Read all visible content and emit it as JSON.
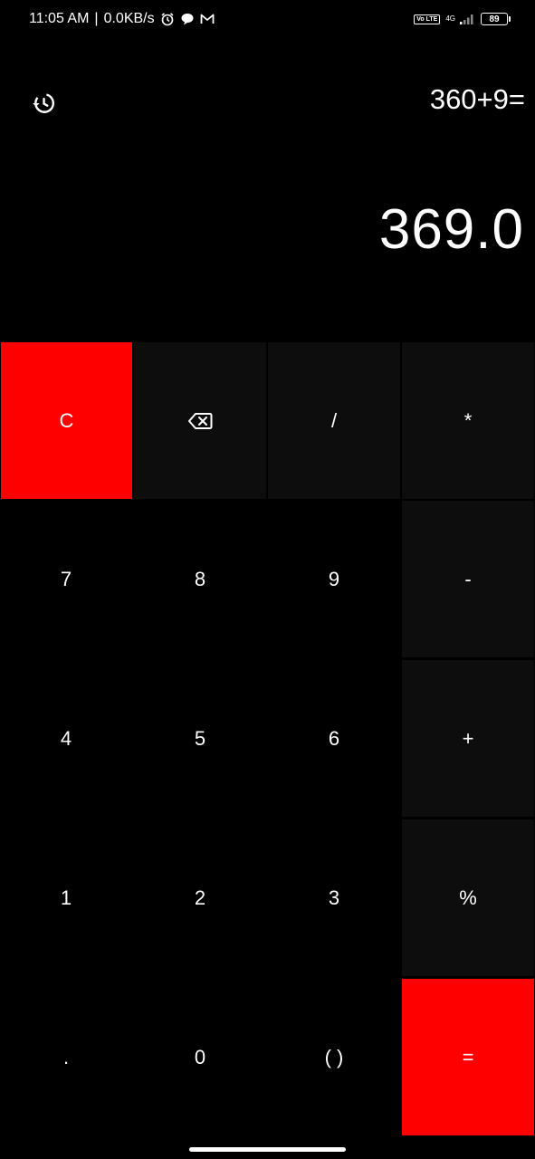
{
  "status_bar": {
    "time": "11:05 AM",
    "separator": "|",
    "network_speed": "0.0KB/s",
    "volte_label": "Vo LTE",
    "network_type": "4G",
    "battery": "89",
    "icons": [
      "alarm-icon",
      "chat-bubble-icon",
      "gmail-icon",
      "volte-icon",
      "signal-icon",
      "battery-icon"
    ]
  },
  "display": {
    "expression": "360+9=",
    "result": "369.0",
    "history_icon": "history-icon"
  },
  "keypad": {
    "clear": "C",
    "backspace_icon": "backspace-icon",
    "divide": "/",
    "multiply": "*",
    "seven": "7",
    "eight": "8",
    "nine": "9",
    "minus": "-",
    "four": "4",
    "five": "5",
    "six": "6",
    "plus": "+",
    "one": "1",
    "two": "2",
    "three": "3",
    "percent": "%",
    "dot": ".",
    "zero": "0",
    "parentheses": "( )",
    "equals": "="
  },
  "colors": {
    "background": "#000000",
    "accent": "#ff0000",
    "operator_key": "#0d0d0d",
    "text": "#ffffff"
  }
}
